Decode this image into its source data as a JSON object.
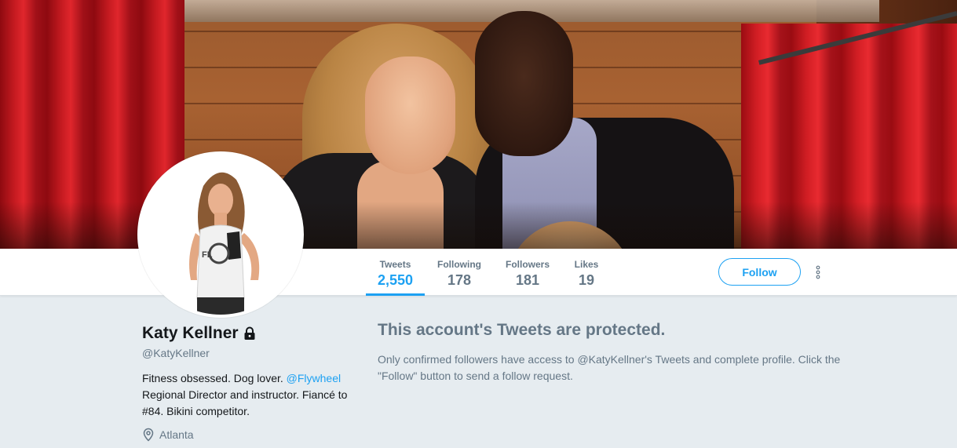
{
  "profile": {
    "name": "Katy Kellner",
    "handle": "@KatyKellner",
    "bio_before": "Fitness obsessed. Dog lover. ",
    "bio_link": "@Flywheel",
    "bio_after": " Regional Director and instructor. Fiancé to #84. Bikini competitor.",
    "location": "Atlanta"
  },
  "stats": {
    "tweets": {
      "label": "Tweets",
      "value": "2,550"
    },
    "following": {
      "label": "Following",
      "value": "178"
    },
    "followers": {
      "label": "Followers",
      "value": "181"
    },
    "likes": {
      "label": "Likes",
      "value": "19"
    }
  },
  "actions": {
    "follow_label": "Follow",
    "more_icon": "more-vertical-icon"
  },
  "protected": {
    "title": "This account's Tweets are protected.",
    "message": "Only confirmed followers have access to @KatyKellner's Tweets and complete profile. Click the \"Follow\" button to send a follow request."
  },
  "icons": {
    "lock": "lock-icon",
    "location": "location-pin-icon"
  },
  "colors": {
    "accent": "#1da1f2",
    "muted_text": "#657786",
    "page_background": "#e6ecf0"
  }
}
